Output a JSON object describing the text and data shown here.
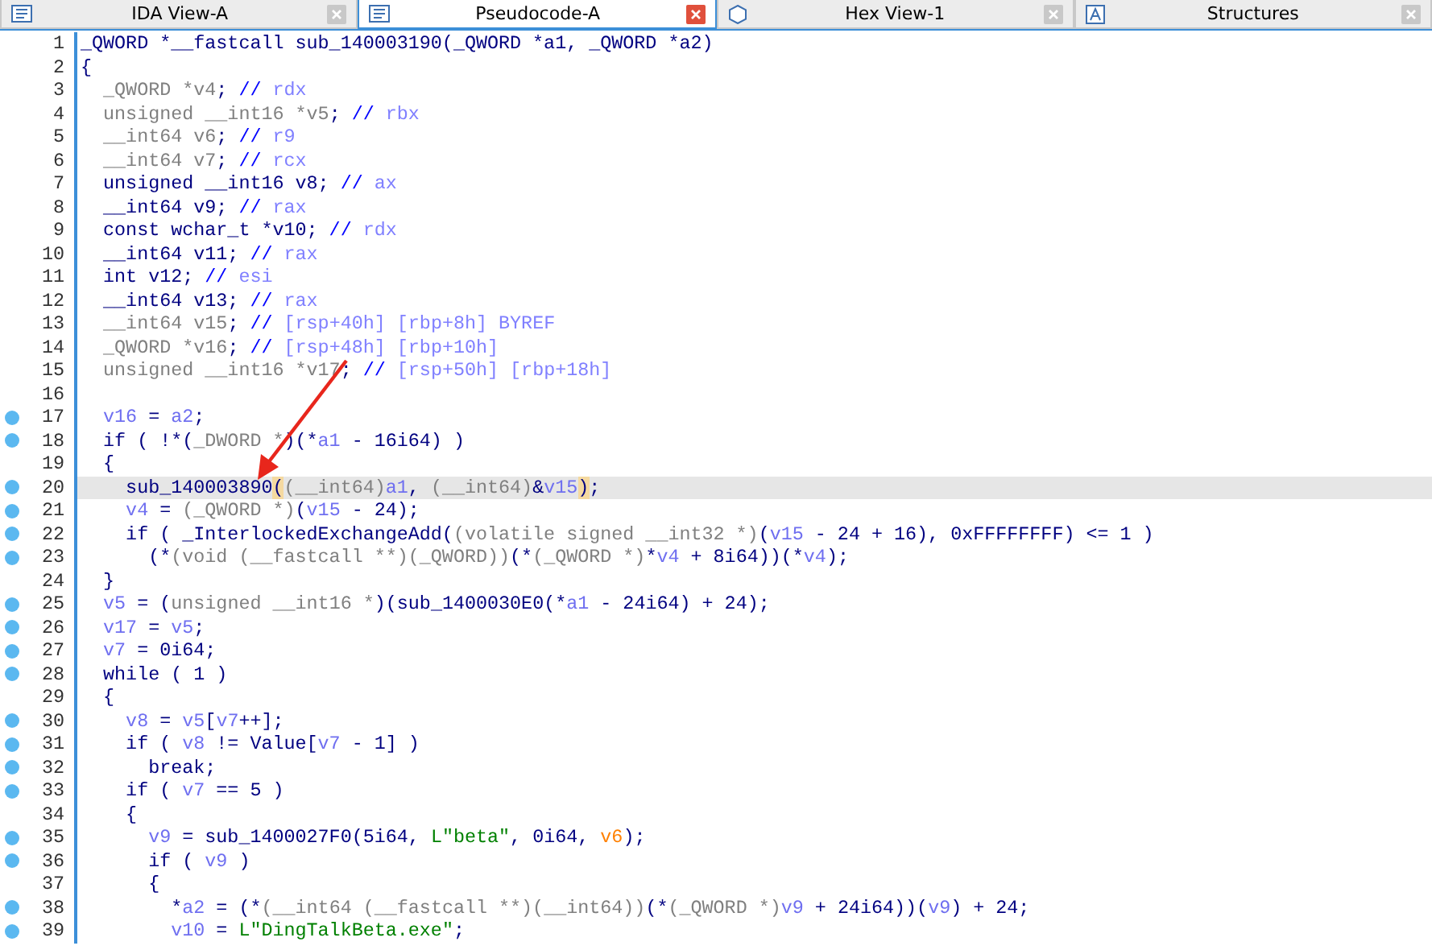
{
  "tabs": [
    {
      "label": "IDA View-A",
      "kind": "listing",
      "selected": false
    },
    {
      "label": "Pseudocode-A",
      "kind": "listing",
      "selected": true
    },
    {
      "label": "Hex View-1",
      "kind": "hex",
      "selected": false
    },
    {
      "label": "Structures",
      "kind": "struct",
      "selected": false
    }
  ],
  "lines": [
    {
      "number": "1",
      "breakpoint": false,
      "highlighted": false,
      "tokens": [
        {
          "text": "_QWORD *__fastcall sub_140003190(_QWORD *a1, _QWORD *a2)",
          "kind": "code"
        }
      ]
    },
    {
      "number": "2",
      "breakpoint": false,
      "highlighted": false,
      "tokens": [
        {
          "text": "{",
          "kind": "code"
        }
      ]
    },
    {
      "number": "3",
      "breakpoint": false,
      "highlighted": false,
      "tokens": [
        {
          "text": "  _QWORD *v4",
          "kind": "dim"
        },
        {
          "text": ";",
          "kind": "code"
        },
        {
          "text": " //",
          "kind": "comment"
        },
        {
          "text": " rdx",
          "kind": "reg"
        }
      ]
    },
    {
      "number": "4",
      "breakpoint": false,
      "highlighted": false,
      "tokens": [
        {
          "text": "  unsigned __int16 *v5",
          "kind": "dim"
        },
        {
          "text": ";",
          "kind": "code"
        },
        {
          "text": " //",
          "kind": "comment"
        },
        {
          "text": " rbx",
          "kind": "reg"
        }
      ]
    },
    {
      "number": "5",
      "breakpoint": false,
      "highlighted": false,
      "tokens": [
        {
          "text": "  __int64 v6",
          "kind": "dim"
        },
        {
          "text": ";",
          "kind": "code"
        },
        {
          "text": " //",
          "kind": "comment"
        },
        {
          "text": " r9",
          "kind": "reg"
        }
      ]
    },
    {
      "number": "6",
      "breakpoint": false,
      "highlighted": false,
      "tokens": [
        {
          "text": "  __int64 v7",
          "kind": "dim"
        },
        {
          "text": ";",
          "kind": "code"
        },
        {
          "text": " //",
          "kind": "comment"
        },
        {
          "text": " rcx",
          "kind": "reg"
        }
      ]
    },
    {
      "number": "7",
      "breakpoint": false,
      "highlighted": false,
      "tokens": [
        {
          "text": "  unsigned __int16 v8;",
          "kind": "code"
        },
        {
          "text": " //",
          "kind": "comment"
        },
        {
          "text": " ax",
          "kind": "reg"
        }
      ]
    },
    {
      "number": "8",
      "breakpoint": false,
      "highlighted": false,
      "tokens": [
        {
          "text": "  __int64 v9;",
          "kind": "code"
        },
        {
          "text": " //",
          "kind": "comment"
        },
        {
          "text": " rax",
          "kind": "reg"
        }
      ]
    },
    {
      "number": "9",
      "breakpoint": false,
      "highlighted": false,
      "tokens": [
        {
          "text": "  const wchar_t *v10;",
          "kind": "code"
        },
        {
          "text": " //",
          "kind": "comment"
        },
        {
          "text": " rdx",
          "kind": "reg"
        }
      ]
    },
    {
      "number": "10",
      "breakpoint": false,
      "highlighted": false,
      "tokens": [
        {
          "text": "  __int64 v11;",
          "kind": "code"
        },
        {
          "text": " //",
          "kind": "comment"
        },
        {
          "text": " rax",
          "kind": "reg"
        }
      ]
    },
    {
      "number": "11",
      "breakpoint": false,
      "highlighted": false,
      "tokens": [
        {
          "text": "  int v12;",
          "kind": "code"
        },
        {
          "text": " //",
          "kind": "comment"
        },
        {
          "text": " esi",
          "kind": "reg"
        }
      ]
    },
    {
      "number": "12",
      "breakpoint": false,
      "highlighted": false,
      "tokens": [
        {
          "text": "  __int64 v13;",
          "kind": "code"
        },
        {
          "text": " //",
          "kind": "comment"
        },
        {
          "text": " rax",
          "kind": "reg"
        }
      ]
    },
    {
      "number": "13",
      "breakpoint": false,
      "highlighted": false,
      "tokens": [
        {
          "text": "  __int64 v15",
          "kind": "dim"
        },
        {
          "text": ";",
          "kind": "code"
        },
        {
          "text": " //",
          "kind": "comment"
        },
        {
          "text": " [rsp+40h] [rbp+8h] BYREF",
          "kind": "reg"
        }
      ]
    },
    {
      "number": "14",
      "breakpoint": false,
      "highlighted": false,
      "tokens": [
        {
          "text": "  _QWORD *v16",
          "kind": "dim"
        },
        {
          "text": ";",
          "kind": "code"
        },
        {
          "text": " //",
          "kind": "comment"
        },
        {
          "text": " [rsp+48h] [rbp+10h]",
          "kind": "reg"
        }
      ]
    },
    {
      "number": "15",
      "breakpoint": false,
      "highlighted": false,
      "tokens": [
        {
          "text": "  unsigned __int16 *v17",
          "kind": "dim"
        },
        {
          "text": ";",
          "kind": "code"
        },
        {
          "text": " //",
          "kind": "comment"
        },
        {
          "text": " [rsp+50h] [rbp+18h]",
          "kind": "reg"
        }
      ]
    },
    {
      "number": "16",
      "breakpoint": false,
      "highlighted": false
    },
    {
      "number": "17",
      "breakpoint": true,
      "highlighted": false,
      "tokens": [
        {
          "text": "  v16",
          "kind": "var"
        },
        {
          "text": " = ",
          "kind": "code"
        },
        {
          "text": "a2",
          "kind": "var"
        },
        {
          "text": ";",
          "kind": "code"
        }
      ]
    },
    {
      "number": "18",
      "breakpoint": true,
      "highlighted": false,
      "tokens": [
        {
          "text": "  if ( !*(",
          "kind": "code"
        },
        {
          "text": "_DWORD *",
          "kind": "dim"
        },
        {
          "text": ")(*",
          "kind": "code"
        },
        {
          "text": "a1",
          "kind": "var"
        },
        {
          "text": " - 16i64) )",
          "kind": "code"
        }
      ]
    },
    {
      "number": "19",
      "breakpoint": false,
      "highlighted": false,
      "tokens": [
        {
          "text": "  {",
          "kind": "code"
        }
      ]
    },
    {
      "number": "20",
      "breakpoint": true,
      "highlighted": true,
      "tokens": [
        {
          "text": "    sub_140003890",
          "kind": "code"
        },
        {
          "text": "(",
          "kind": "match"
        },
        {
          "text": "(__int64)",
          "kind": "dim"
        },
        {
          "text": "a1",
          "kind": "var"
        },
        {
          "text": ", ",
          "kind": "code"
        },
        {
          "text": "(__int64)",
          "kind": "dim"
        },
        {
          "text": "&",
          "kind": "code"
        },
        {
          "text": "v15",
          "kind": "var"
        },
        {
          "text": ")",
          "kind": "match"
        },
        {
          "text": ";",
          "kind": "code"
        }
      ]
    },
    {
      "number": "21",
      "breakpoint": true,
      "highlighted": false,
      "tokens": [
        {
          "text": "    v4",
          "kind": "var"
        },
        {
          "text": " = ",
          "kind": "code"
        },
        {
          "text": "(_QWORD *)",
          "kind": "dim"
        },
        {
          "text": "(",
          "kind": "code"
        },
        {
          "text": "v15",
          "kind": "var"
        },
        {
          "text": " - 24);",
          "kind": "code"
        }
      ]
    },
    {
      "number": "22",
      "breakpoint": true,
      "highlighted": false,
      "tokens": [
        {
          "text": "    if ( _InterlockedExchangeAdd(",
          "kind": "code"
        },
        {
          "text": "(volatile signed __int32 *)",
          "kind": "dim"
        },
        {
          "text": "(",
          "kind": "code"
        },
        {
          "text": "v15",
          "kind": "var"
        },
        {
          "text": " - 24 + 16), 0xFFFFFFFF) <= 1 )",
          "kind": "code"
        }
      ]
    },
    {
      "number": "23",
      "breakpoint": true,
      "highlighted": false,
      "tokens": [
        {
          "text": "      (*",
          "kind": "code"
        },
        {
          "text": "(void (__fastcall **)(_QWORD))",
          "kind": "dim"
        },
        {
          "text": "(*",
          "kind": "code"
        },
        {
          "text": "(_QWORD *)",
          "kind": "dim"
        },
        {
          "text": "*",
          "kind": "code"
        },
        {
          "text": "v4",
          "kind": "var"
        },
        {
          "text": " + 8i64))(*",
          "kind": "code"
        },
        {
          "text": "v4",
          "kind": "var"
        },
        {
          "text": ");",
          "kind": "code"
        }
      ]
    },
    {
      "number": "24",
      "breakpoint": false,
      "highlighted": false,
      "tokens": [
        {
          "text": "  }",
          "kind": "code"
        }
      ]
    },
    {
      "number": "25",
      "breakpoint": true,
      "highlighted": false,
      "tokens": [
        {
          "text": "  v5",
          "kind": "var"
        },
        {
          "text": " = (",
          "kind": "code"
        },
        {
          "text": "unsigned __int16 *",
          "kind": "dim"
        },
        {
          "text": ")(sub_1400030E0(*",
          "kind": "code"
        },
        {
          "text": "a1",
          "kind": "var"
        },
        {
          "text": " - 24i64) + 24);",
          "kind": "code"
        }
      ]
    },
    {
      "number": "26",
      "breakpoint": true,
      "highlighted": false,
      "tokens": [
        {
          "text": "  v17",
          "kind": "var"
        },
        {
          "text": " = ",
          "kind": "code"
        },
        {
          "text": "v5",
          "kind": "var"
        },
        {
          "text": ";",
          "kind": "code"
        }
      ]
    },
    {
      "number": "27",
      "breakpoint": true,
      "highlighted": false,
      "tokens": [
        {
          "text": "  v7",
          "kind": "var"
        },
        {
          "text": " = 0i64;",
          "kind": "code"
        }
      ]
    },
    {
      "number": "28",
      "breakpoint": true,
      "highlighted": false,
      "tokens": [
        {
          "text": "  while ( 1 )",
          "kind": "code"
        }
      ]
    },
    {
      "number": "29",
      "breakpoint": false,
      "highlighted": false,
      "tokens": [
        {
          "text": "  {",
          "kind": "code"
        }
      ]
    },
    {
      "number": "30",
      "breakpoint": true,
      "highlighted": false,
      "tokens": [
        {
          "text": "    v8",
          "kind": "var"
        },
        {
          "text": " = ",
          "kind": "code"
        },
        {
          "text": "v5",
          "kind": "var"
        },
        {
          "text": "[",
          "kind": "code"
        },
        {
          "text": "v7",
          "kind": "var"
        },
        {
          "text": "++];",
          "kind": "code"
        }
      ]
    },
    {
      "number": "31",
      "breakpoint": true,
      "highlighted": false,
      "tokens": [
        {
          "text": "    if ( ",
          "kind": "code"
        },
        {
          "text": "v8",
          "kind": "var"
        },
        {
          "text": " != Value[",
          "kind": "code"
        },
        {
          "text": "v7",
          "kind": "var"
        },
        {
          "text": " - 1] )",
          "kind": "code"
        }
      ]
    },
    {
      "number": "32",
      "breakpoint": true,
      "highlighted": false,
      "tokens": [
        {
          "text": "      break;",
          "kind": "code"
        }
      ]
    },
    {
      "number": "33",
      "breakpoint": true,
      "highlighted": false,
      "tokens": [
        {
          "text": "    if ( ",
          "kind": "code"
        },
        {
          "text": "v7",
          "kind": "var"
        },
        {
          "text": " == 5 )",
          "kind": "code"
        }
      ]
    },
    {
      "number": "34",
      "breakpoint": false,
      "highlighted": false,
      "tokens": [
        {
          "text": "    {",
          "kind": "code"
        }
      ]
    },
    {
      "number": "35",
      "breakpoint": true,
      "highlighted": false,
      "tokens": [
        {
          "text": "      v9",
          "kind": "var"
        },
        {
          "text": " = sub_1400027F0(5i64, ",
          "kind": "code"
        },
        {
          "text": "L\"beta\"",
          "kind": "string"
        },
        {
          "text": ", 0i64, ",
          "kind": "code"
        },
        {
          "text": "v6",
          "kind": "arg"
        },
        {
          "text": ");",
          "kind": "code"
        }
      ]
    },
    {
      "number": "36",
      "breakpoint": true,
      "highlighted": false,
      "tokens": [
        {
          "text": "      if ( ",
          "kind": "code"
        },
        {
          "text": "v9",
          "kind": "var"
        },
        {
          "text": " )",
          "kind": "code"
        }
      ]
    },
    {
      "number": "37",
      "breakpoint": false,
      "highlighted": false,
      "tokens": [
        {
          "text": "      {",
          "kind": "code"
        }
      ]
    },
    {
      "number": "38",
      "breakpoint": true,
      "highlighted": false,
      "tokens": [
        {
          "text": "        *",
          "kind": "code"
        },
        {
          "text": "a2",
          "kind": "var"
        },
        {
          "text": " = (*",
          "kind": "code"
        },
        {
          "text": "(__int64 (__fastcall **)(__int64))",
          "kind": "dim"
        },
        {
          "text": "(*",
          "kind": "code"
        },
        {
          "text": "(_QWORD *)",
          "kind": "dim"
        },
        {
          "text": "v9",
          "kind": "var"
        },
        {
          "text": " + 24i64))(",
          "kind": "code"
        },
        {
          "text": "v9",
          "kind": "var"
        },
        {
          "text": ") + 24;",
          "kind": "code"
        }
      ]
    },
    {
      "number": "39",
      "breakpoint": true,
      "highlighted": false,
      "tokens": [
        {
          "text": "        v10",
          "kind": "var"
        },
        {
          "text": " = ",
          "kind": "code"
        },
        {
          "text": "L\"DingTalkBeta.exe\"",
          "kind": "string"
        },
        {
          "text": ";",
          "kind": "code"
        }
      ]
    }
  ]
}
